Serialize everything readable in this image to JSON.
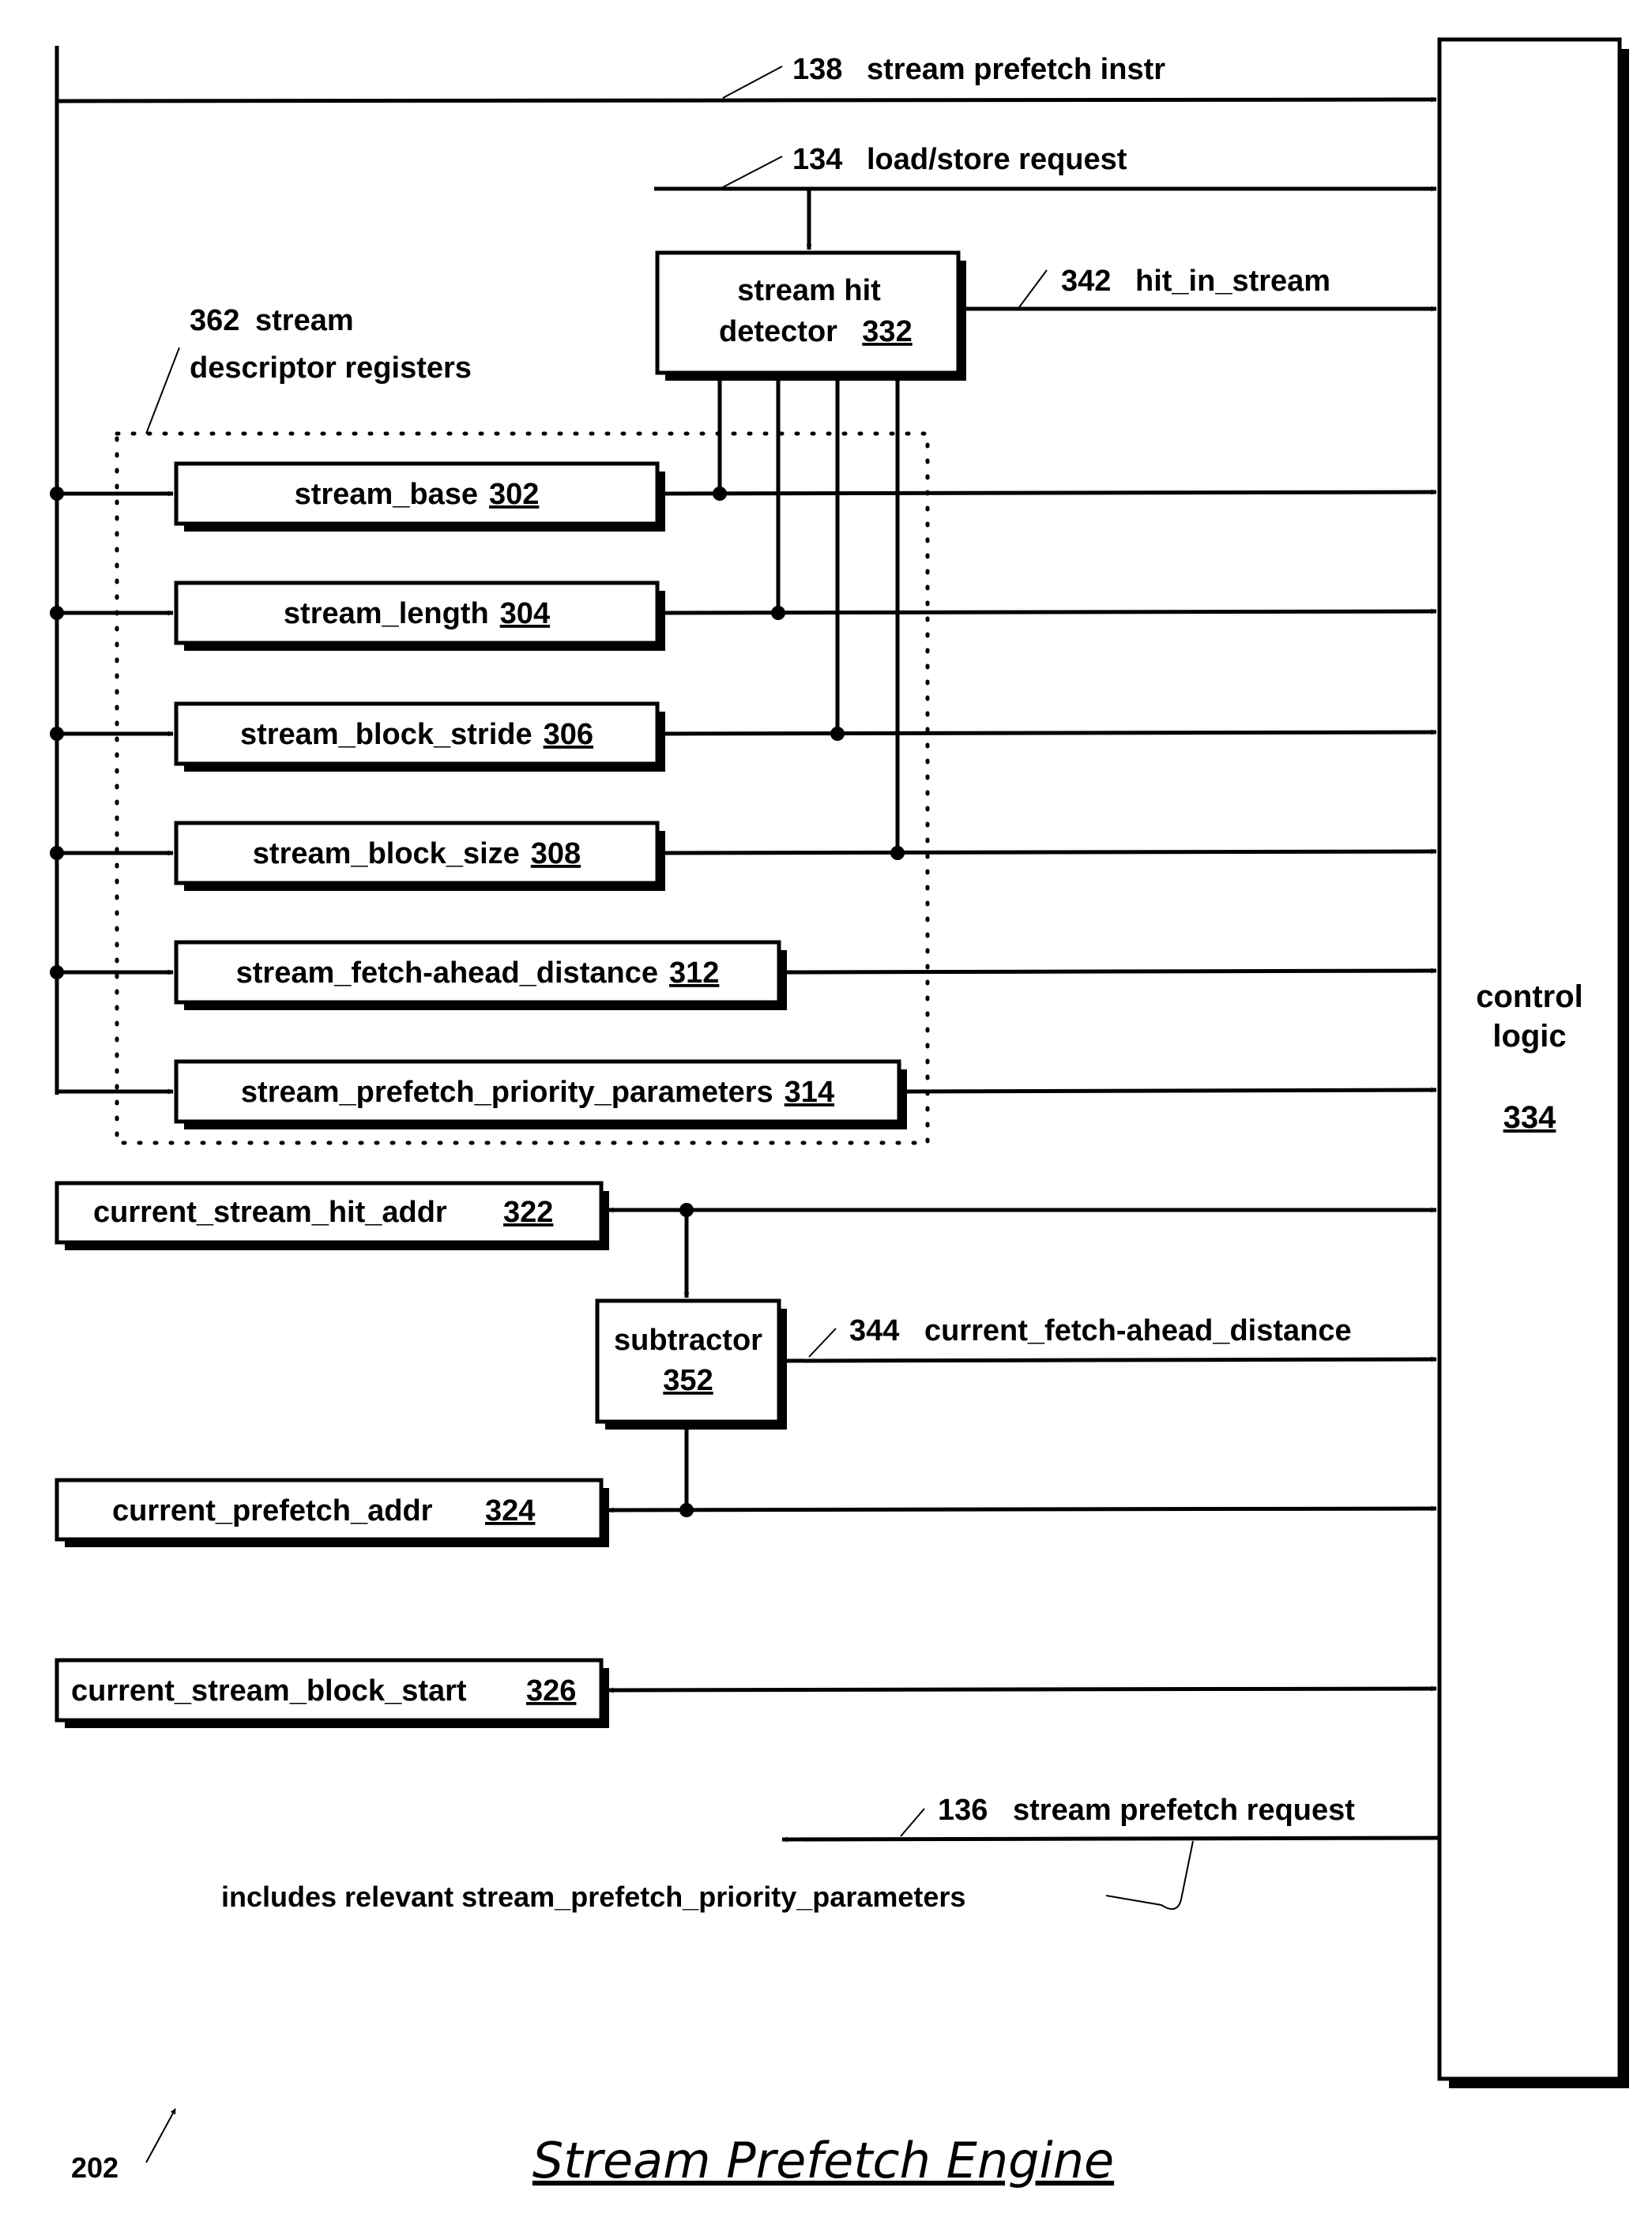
{
  "figure": {
    "reference_number": "202",
    "title": "Stream Prefetch Engine"
  },
  "signals": {
    "stream_prefetch_instr": {
      "number": "138",
      "label": "stream prefetch instr"
    },
    "load_store_request": {
      "number": "134",
      "label": "load/store request"
    },
    "hit_in_stream": {
      "number": "342",
      "label": "hit_in_stream"
    },
    "current_fetch_ahead_distance": {
      "number": "344",
      "label": "current_fetch-ahead_distance"
    },
    "stream_prefetch_request": {
      "number": "136",
      "label": "stream prefetch request"
    },
    "stream_prefetch_request_note": "includes relevant stream_prefetch_priority_parameters"
  },
  "register_group": {
    "number": "362",
    "label_line1": "stream",
    "label_line2": "descriptor registers"
  },
  "blocks": {
    "stream_hit_detector": {
      "label_line1": "stream hit",
      "label_line2": "detector",
      "number": "332"
    },
    "control_logic": {
      "label_line1": "control",
      "label_line2": "logic",
      "number": "334"
    },
    "subtractor": {
      "label": "subtractor",
      "number": "352"
    }
  },
  "descriptor_registers": [
    {
      "name": "stream_base",
      "number": "302"
    },
    {
      "name": "stream_length",
      "number": "304"
    },
    {
      "name": "stream_block_stride",
      "number": "306"
    },
    {
      "name": "stream_block_size",
      "number": "308"
    },
    {
      "name": "stream_fetch-ahead_distance",
      "number": "312"
    },
    {
      "name": "stream_prefetch_priority_parameters",
      "number": "314"
    }
  ],
  "state_registers": [
    {
      "name": "current_stream_hit_addr",
      "number": "322"
    },
    {
      "name": "current_prefetch_addr",
      "number": "324"
    },
    {
      "name": "current_stream_block_start",
      "number": "326"
    }
  ]
}
